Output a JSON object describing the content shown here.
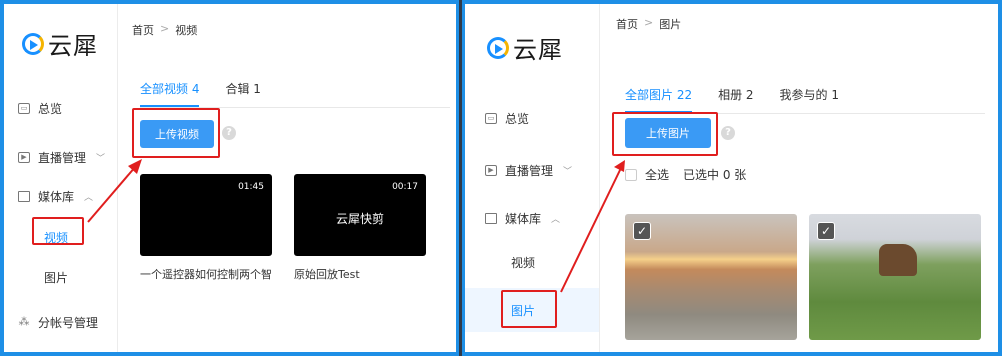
{
  "brand": {
    "name": "云犀"
  },
  "left_panel": {
    "sidebar": {
      "items": [
        {
          "label": "总览",
          "icon": "overview-icon"
        },
        {
          "label": "直播管理",
          "icon": "live-icon"
        },
        {
          "label": "媒体库",
          "icon": "folder-icon"
        }
      ],
      "media_sub": [
        "视频",
        "图片"
      ],
      "account_label": "分帐号管理"
    },
    "breadcrumb": {
      "home": "首页",
      "sep": ">",
      "current": "视频"
    },
    "tabs": [
      "全部视频 4",
      "合辑 1"
    ],
    "upload_label": "上传视频",
    "help": "?",
    "videos": [
      {
        "duration": "01:45",
        "overlay": "",
        "title": "一个遥控器如何控制两个智..."
      },
      {
        "duration": "00:17",
        "overlay": "云犀快剪",
        "title": "原始回放Test"
      }
    ]
  },
  "right_panel": {
    "sidebar": {
      "items": [
        {
          "label": "总览"
        },
        {
          "label": "直播管理"
        },
        {
          "label": "媒体库"
        }
      ],
      "media_sub": [
        "视频",
        "图片"
      ]
    },
    "breadcrumb": {
      "home": "首页",
      "sep": ">",
      "current": "图片"
    },
    "tabs": [
      "全部图片 22",
      "相册 2",
      "我参与的 1"
    ],
    "upload_label": "上传图片",
    "help": "?",
    "select_all": "全选",
    "selected_count": "已选中 0 张",
    "photos": [
      {
        "checked": true
      },
      {
        "checked": true
      }
    ]
  },
  "colors": {
    "accent": "#1890ff",
    "button": "#3a9af5",
    "highlight": "#e01e1e",
    "frame": "#1e8fe6"
  }
}
